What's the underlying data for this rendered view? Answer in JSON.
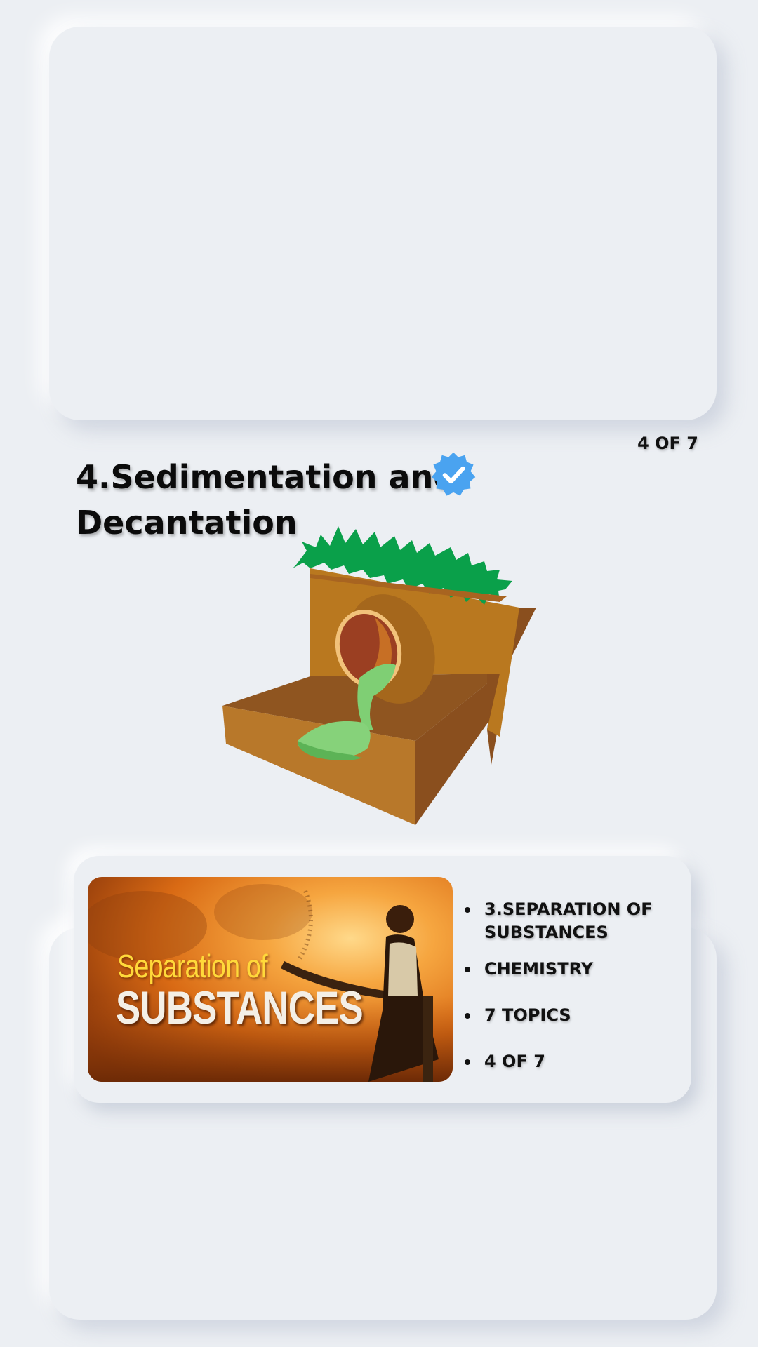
{
  "progress": "4 OF 7",
  "lesson": {
    "title": "4.Sedimentation and Decantation",
    "badge_icon": "verified-badge-icon",
    "badge_color": "#4aa3f0"
  },
  "illustration": "sedimentation-decantation-illustration",
  "course": {
    "thumbnail": {
      "line1": "Separation of",
      "line2": "SUBSTANCES"
    },
    "meta": [
      "3.SEPARATION OF SUBSTANCES",
      "CHEMISTRY",
      "7 TOPICS",
      "4 OF 7"
    ]
  },
  "colors": {
    "background": "#eceff3",
    "text": "#111111"
  }
}
